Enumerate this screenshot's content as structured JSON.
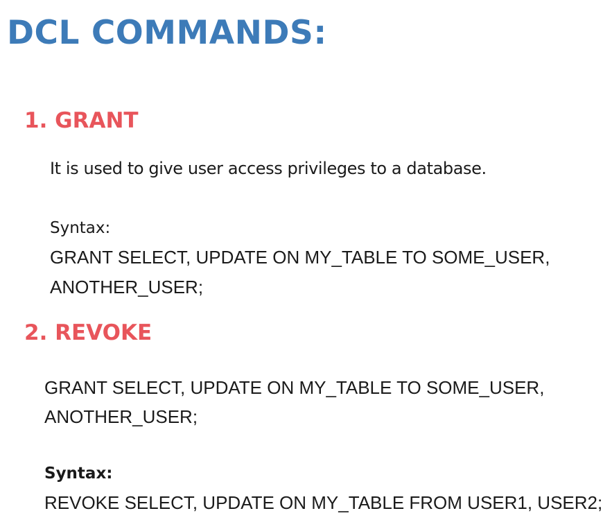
{
  "title": "DCL COMMANDS:",
  "grant": {
    "heading": "1. GRANT",
    "description": "It is used to give user access privileges to a database.",
    "syntax_label": "Syntax:",
    "code_line1": "GRANT SELECT, UPDATE ON MY_TABLE TO SOME_USER,",
    "code_line2": "ANOTHER_USER;"
  },
  "revoke": {
    "heading": "2. REVOKE",
    "code_line1": "GRANT SELECT, UPDATE ON MY_TABLE TO SOME_USER,",
    "code_line2": "ANOTHER_USER;",
    "syntax_label": "Syntax:",
    "syntax_code": "REVOKE SELECT, UPDATE ON MY_TABLE FROM USER1, USER2;"
  },
  "colors": {
    "title": "#3d7bb8",
    "heading": "#e8555b",
    "text": "#1a1a1a",
    "background": "#ffffff"
  }
}
